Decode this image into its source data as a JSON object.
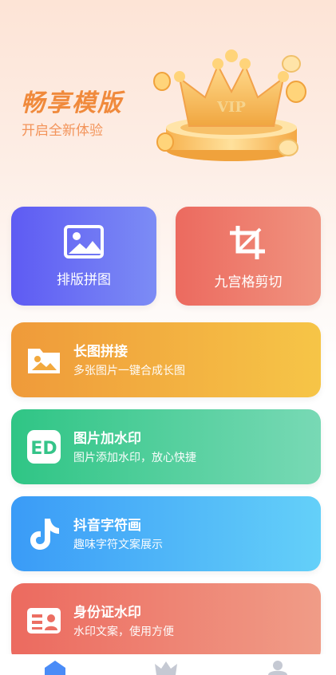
{
  "hero": {
    "title": "畅享模版",
    "subtitle": "开启全新体验",
    "crown_text": "VIP"
  },
  "tools": [
    {
      "label": "排版拼图",
      "icon": "image-icon",
      "color_from": "#5e5bf3",
      "color_to": "#7c8cf5"
    },
    {
      "label": "九宫格剪切",
      "icon": "crop-icon",
      "color_from": "#ec6a5f",
      "color_to": "#f0937f"
    }
  ],
  "features": [
    {
      "title": "长图拼接",
      "subtitle": "多张图片一键合成长图",
      "icon": "folder-image-icon",
      "color_from": "#ef9a3a",
      "color_to": "#f6c547"
    },
    {
      "title": "图片加水印",
      "subtitle": "图片添加水印，放心快捷",
      "icon": "stamp-icon",
      "color_from": "#2fc585",
      "color_to": "#78d9b5"
    },
    {
      "title": "抖音字符画",
      "subtitle": "趣味字符文案展示",
      "icon": "tiktok-icon",
      "color_from": "#3a9bf7",
      "color_to": "#64d0f9"
    },
    {
      "title": "身份证水印",
      "subtitle": "水印文案，使用方便",
      "icon": "id-card-icon",
      "color_from": "#ec6a5f",
      "color_to": "#f09c87"
    }
  ],
  "tabbar": {
    "tabs": [
      {
        "icon": "home-icon",
        "active": true,
        "color": "#4a8cf7"
      },
      {
        "icon": "crown-icon",
        "active": false,
        "color": "#c5c9d3"
      },
      {
        "icon": "user-icon",
        "active": false,
        "color": "#c5c9d3"
      }
    ]
  }
}
